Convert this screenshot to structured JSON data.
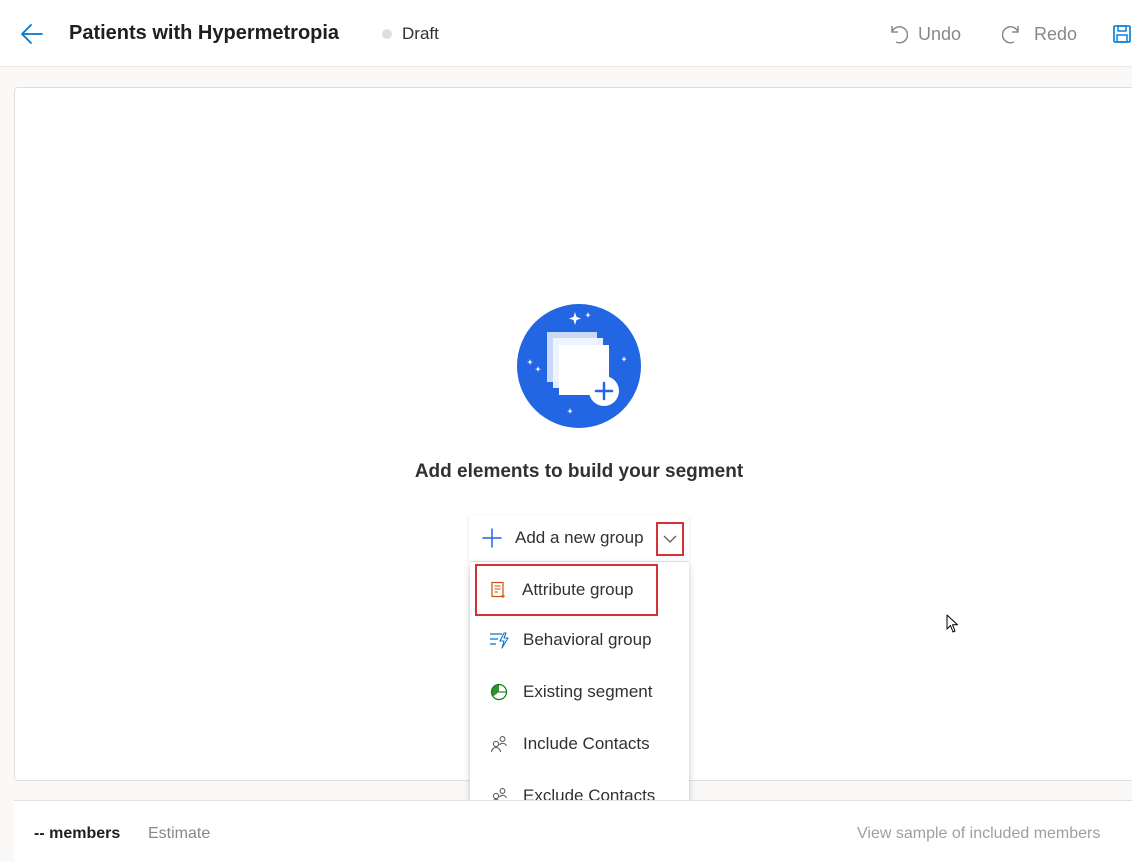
{
  "header": {
    "title": "Patients with Hypermetropia",
    "status": "Draft",
    "undo_label": "Undo",
    "redo_label": "Redo"
  },
  "canvas": {
    "empty_heading": "Add elements to build your segment",
    "add_group_label": "Add a new group"
  },
  "menu": {
    "items": [
      {
        "label": "Attribute group",
        "icon": "attribute-group-icon"
      },
      {
        "label": "Behavioral group",
        "icon": "behavioral-group-icon"
      },
      {
        "label": "Existing segment",
        "icon": "existing-segment-icon"
      },
      {
        "label": "Include Contacts",
        "icon": "include-contacts-icon"
      },
      {
        "label": "Exclude Contacts",
        "icon": "exclude-contacts-icon"
      }
    ]
  },
  "footer": {
    "members": "-- members",
    "estimate": "Estimate",
    "sample_link": "View sample of included members"
  },
  "colors": {
    "accent": "#2266e3",
    "highlight_border": "#d13438",
    "attribute_icon": "#ca5010",
    "behavioral_icon": "#0078d4",
    "segment_icon": "#107c10"
  }
}
